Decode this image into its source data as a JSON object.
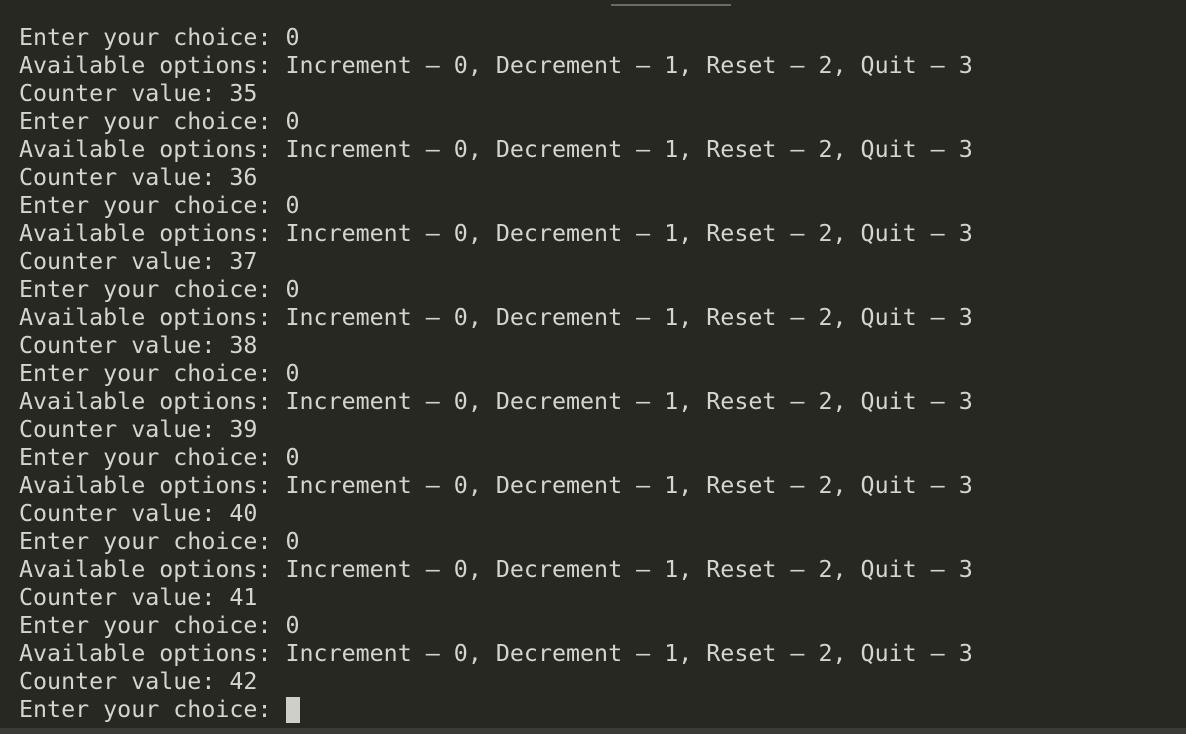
{
  "terminal": {
    "lines": [
      "Enter your choice: 0",
      "Available options: Increment – 0, Decrement – 1, Reset – 2, Quit – 3",
      "Counter value: 35",
      "Enter your choice: 0",
      "Available options: Increment – 0, Decrement – 1, Reset – 2, Quit – 3",
      "Counter value: 36",
      "Enter your choice: 0",
      "Available options: Increment – 0, Decrement – 1, Reset – 2, Quit – 3",
      "Counter value: 37",
      "Enter your choice: 0",
      "Available options: Increment – 0, Decrement – 1, Reset – 2, Quit – 3",
      "Counter value: 38",
      "Enter your choice: 0",
      "Available options: Increment – 0, Decrement – 1, Reset – 2, Quit – 3",
      "Counter value: 39",
      "Enter your choice: 0",
      "Available options: Increment – 0, Decrement – 1, Reset – 2, Quit – 3",
      "Counter value: 40",
      "Enter your choice: 0",
      "Available options: Increment – 0, Decrement – 1, Reset – 2, Quit – 3",
      "Counter value: 41",
      "Enter your choice: 0",
      "Available options: Increment – 0, Decrement – 1, Reset – 2, Quit – 3",
      "Counter value: 42"
    ],
    "prompt": "Enter your choice: "
  },
  "colors": {
    "background": "#272822",
    "text": "#d5d5d0",
    "cursor": "#cfcfca"
  }
}
